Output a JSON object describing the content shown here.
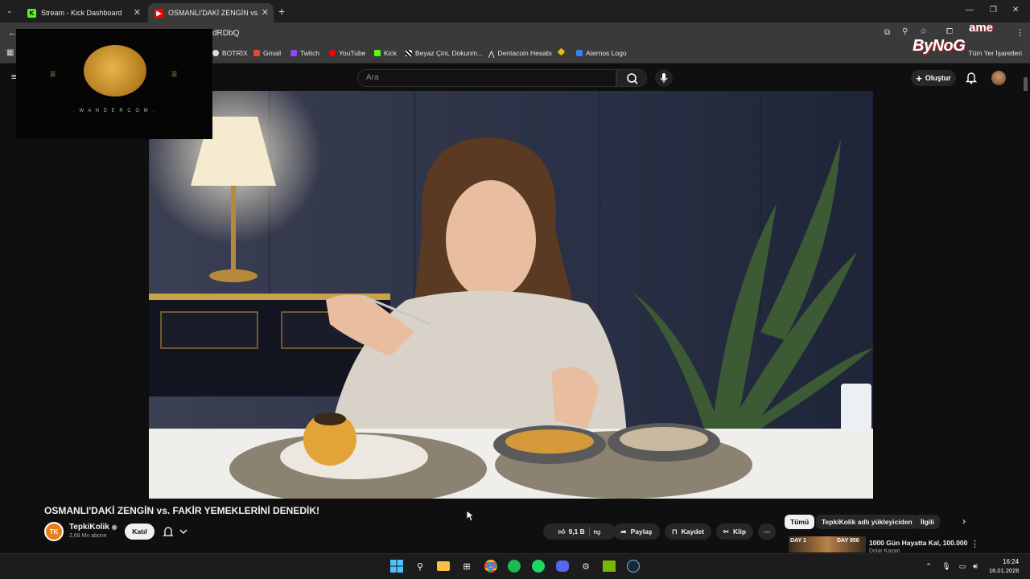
{
  "browser": {
    "tabs": [
      {
        "label": "Stream - Kick Dashboard",
        "active": false
      },
      {
        "label": "OSMANLI'DAKİ ZENGİN vs. FAKİ",
        "active": true
      }
    ],
    "url_fragment": "dRDbQ",
    "bookmarks": [
      "BOTRİX",
      "Gmail",
      "Twitch",
      "YouTube",
      "Kick",
      "Beyaz Çini, Dokunm...",
      "Dentacoin Hesabı",
      "Aternos Logo"
    ],
    "all_bookmarks": "Tüm Yer İşaretleri"
  },
  "overlay": {
    "logo_text": "ByNoG",
    "logo_ame": "ame",
    "watermark": ". W A N D E R C O M ."
  },
  "youtube": {
    "search_placeholder": "Ara",
    "create_label": "Oluştur",
    "video_title": "OSMANLI'DAKİ ZENGİN vs. FAKİR YEMEKLERİNİ DENEDİK!",
    "channel_initials": "TK",
    "channel_name": "TepkiKolik",
    "subscribers": "2,68 Mn abone",
    "join_label": "Katıl",
    "likes": "9,1 B",
    "share_label": "Paylaş",
    "save_label": "Kaydet",
    "clip_label": "Klip",
    "chips": [
      "Tümü",
      "TepkiKolik adlı yükleyiciden",
      "İlgili"
    ],
    "recommendation": {
      "title": "1000 Gün Hayatta Kal, 100.000",
      "channel": "Dolar Kazan",
      "day_left": "DAY 1",
      "day_right": "DAY 956"
    }
  },
  "taskbar": {
    "time": "16:24",
    "date": "16.01.2026"
  },
  "colors": {
    "kick_green": "#53fc18",
    "youtube_red": "#ff0000",
    "brand_red": "#c81e2b"
  }
}
